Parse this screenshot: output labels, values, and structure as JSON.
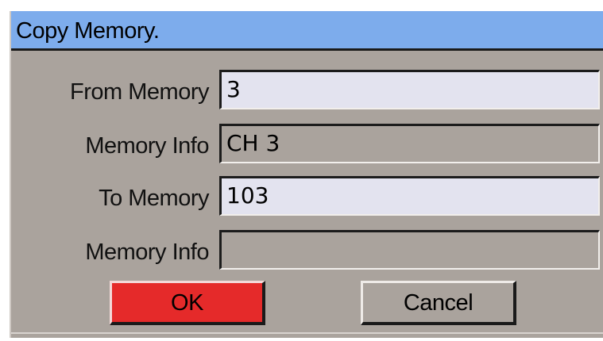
{
  "dialog": {
    "title": "Copy Memory."
  },
  "form": {
    "from_memory": {
      "label": "From Memory",
      "value": "3"
    },
    "from_info": {
      "label": "Memory Info",
      "value": "CH 3"
    },
    "to_memory": {
      "label": "To Memory",
      "value": "103"
    },
    "to_info": {
      "label": "Memory Info",
      "value": ""
    }
  },
  "buttons": {
    "ok_label": "OK",
    "cancel_label": "Cancel"
  },
  "colors": {
    "titlebar": "#7dacec",
    "dialog_bg": "#aaa39d",
    "input_bg": "#e3e3ef",
    "ok_button": "#e52a2a"
  }
}
